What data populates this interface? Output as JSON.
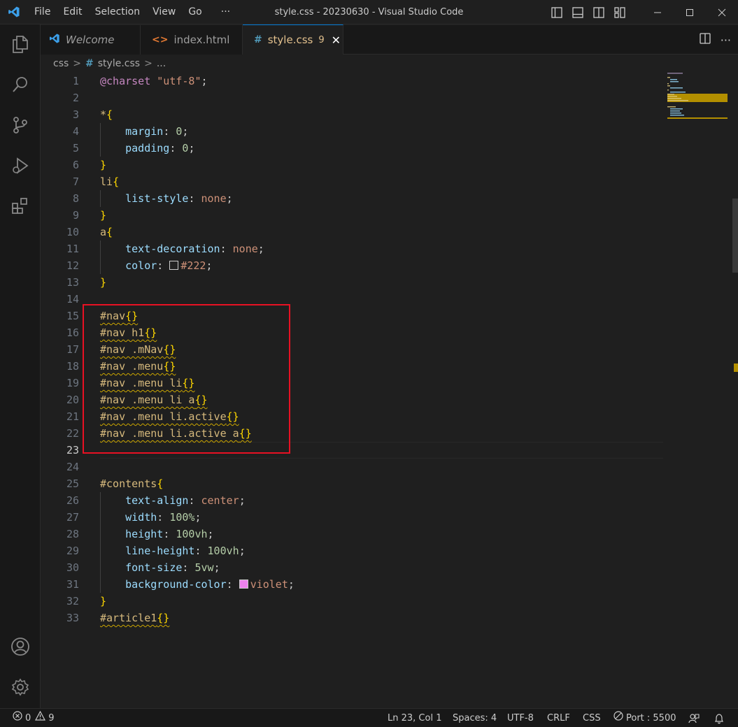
{
  "window": {
    "title": "style.css - 20230630 - Visual Studio Code"
  },
  "menu": [
    "File",
    "Edit",
    "Selection",
    "View",
    "Go",
    "···"
  ],
  "tabs": [
    {
      "label": "Welcome",
      "icon": "vscode-icon"
    },
    {
      "label": "index.html",
      "icon": "html-icon",
      "icon_glyph": "<>"
    },
    {
      "label": "style.css",
      "icon": "css-hash-icon",
      "icon_glyph": "#",
      "badge": "9",
      "close": "✕"
    }
  ],
  "breadcrumb": {
    "folder": "css",
    "sep": ">",
    "hash": "#",
    "file": "style.css",
    "more": "..."
  },
  "editor": {
    "current_line": "23",
    "lines": [
      {
        "n": "1",
        "indent": "",
        "tokens": [
          {
            "c": "t-at",
            "t": "@charset"
          },
          {
            "c": "t-punc",
            "t": " "
          },
          {
            "c": "t-str",
            "t": "\"utf-8\""
          },
          {
            "c": "t-punc",
            "t": ";"
          }
        ]
      },
      {
        "n": "2",
        "indent": "",
        "tokens": []
      },
      {
        "n": "3",
        "indent": "",
        "tokens": [
          {
            "c": "t-sel",
            "t": "*"
          },
          {
            "c": "t-brace",
            "t": "{"
          }
        ]
      },
      {
        "n": "4",
        "indent": "    ",
        "tokens": [
          {
            "c": "t-prop",
            "t": "margin"
          },
          {
            "c": "t-punc",
            "t": ": "
          },
          {
            "c": "t-num",
            "t": "0"
          },
          {
            "c": "t-punc",
            "t": ";"
          }
        ]
      },
      {
        "n": "5",
        "indent": "    ",
        "tokens": [
          {
            "c": "t-prop",
            "t": "padding"
          },
          {
            "c": "t-punc",
            "t": ": "
          },
          {
            "c": "t-num",
            "t": "0"
          },
          {
            "c": "t-punc",
            "t": ";"
          }
        ]
      },
      {
        "n": "6",
        "indent": "",
        "tokens": [
          {
            "c": "t-brace",
            "t": "}"
          }
        ]
      },
      {
        "n": "7",
        "indent": "",
        "tokens": [
          {
            "c": "t-tag",
            "t": "li"
          },
          {
            "c": "t-brace",
            "t": "{"
          }
        ]
      },
      {
        "n": "8",
        "indent": "    ",
        "tokens": [
          {
            "c": "t-prop",
            "t": "list-style"
          },
          {
            "c": "t-punc",
            "t": ": "
          },
          {
            "c": "t-val",
            "t": "none"
          },
          {
            "c": "t-punc",
            "t": ";"
          }
        ]
      },
      {
        "n": "9",
        "indent": "",
        "tokens": [
          {
            "c": "t-brace",
            "t": "}"
          }
        ]
      },
      {
        "n": "10",
        "indent": "",
        "tokens": [
          {
            "c": "t-tag",
            "t": "a"
          },
          {
            "c": "t-brace",
            "t": "{"
          }
        ]
      },
      {
        "n": "11",
        "indent": "    ",
        "tokens": [
          {
            "c": "t-prop",
            "t": "text-decoration"
          },
          {
            "c": "t-punc",
            "t": ": "
          },
          {
            "c": "t-val",
            "t": "none"
          },
          {
            "c": "t-punc",
            "t": ";"
          }
        ]
      },
      {
        "n": "12",
        "indent": "    ",
        "tokens": [
          {
            "c": "t-prop",
            "t": "color"
          },
          {
            "c": "t-punc",
            "t": ": "
          },
          {
            "c": "swatch",
            "t": "",
            "color": "#222222"
          },
          {
            "c": "t-val",
            "t": "#222"
          },
          {
            "c": "t-punc",
            "t": ";"
          }
        ]
      },
      {
        "n": "13",
        "indent": "",
        "tokens": [
          {
            "c": "t-brace",
            "t": "}"
          }
        ]
      },
      {
        "n": "14",
        "indent": "",
        "tokens": []
      },
      {
        "n": "15",
        "indent": "",
        "tokens": [
          {
            "c": "t-sel warn",
            "t": "#nav"
          },
          {
            "c": "t-brace warn",
            "t": "{}"
          }
        ]
      },
      {
        "n": "16",
        "indent": "",
        "tokens": [
          {
            "c": "t-sel warn",
            "t": "#nav h1"
          },
          {
            "c": "t-brace warn",
            "t": "{}"
          }
        ]
      },
      {
        "n": "17",
        "indent": "",
        "tokens": [
          {
            "c": "t-sel warn",
            "t": "#nav .mNav"
          },
          {
            "c": "t-brace warn",
            "t": "{}"
          }
        ]
      },
      {
        "n": "18",
        "indent": "",
        "tokens": [
          {
            "c": "t-sel warn",
            "t": "#nav .menu"
          },
          {
            "c": "t-brace warn",
            "t": "{}"
          }
        ]
      },
      {
        "n": "19",
        "indent": "",
        "tokens": [
          {
            "c": "t-sel warn",
            "t": "#nav .menu li"
          },
          {
            "c": "t-brace warn",
            "t": "{}"
          }
        ]
      },
      {
        "n": "20",
        "indent": "",
        "tokens": [
          {
            "c": "t-sel warn",
            "t": "#nav .menu li a"
          },
          {
            "c": "t-brace warn",
            "t": "{}"
          }
        ]
      },
      {
        "n": "21",
        "indent": "",
        "tokens": [
          {
            "c": "t-sel warn",
            "t": "#nav .menu li.active"
          },
          {
            "c": "t-brace warn",
            "t": "{}"
          }
        ]
      },
      {
        "n": "22",
        "indent": "",
        "tokens": [
          {
            "c": "t-sel warn",
            "t": "#nav .menu li.active a"
          },
          {
            "c": "t-brace warn",
            "t": "{}"
          }
        ]
      },
      {
        "n": "23",
        "indent": "",
        "tokens": []
      },
      {
        "n": "24",
        "indent": "",
        "tokens": []
      },
      {
        "n": "25",
        "indent": "",
        "tokens": [
          {
            "c": "t-sel",
            "t": "#contents"
          },
          {
            "c": "t-brace",
            "t": "{"
          }
        ]
      },
      {
        "n": "26",
        "indent": "    ",
        "tokens": [
          {
            "c": "t-prop",
            "t": "text-align"
          },
          {
            "c": "t-punc",
            "t": ": "
          },
          {
            "c": "t-val",
            "t": "center"
          },
          {
            "c": "t-punc",
            "t": ";"
          }
        ]
      },
      {
        "n": "27",
        "indent": "    ",
        "tokens": [
          {
            "c": "t-prop",
            "t": "width"
          },
          {
            "c": "t-punc",
            "t": ": "
          },
          {
            "c": "t-num",
            "t": "100%"
          },
          {
            "c": "t-punc",
            "t": ";"
          }
        ]
      },
      {
        "n": "28",
        "indent": "    ",
        "tokens": [
          {
            "c": "t-prop",
            "t": "height"
          },
          {
            "c": "t-punc",
            "t": ": "
          },
          {
            "c": "t-num",
            "t": "100vh"
          },
          {
            "c": "t-punc",
            "t": ";"
          }
        ]
      },
      {
        "n": "29",
        "indent": "    ",
        "tokens": [
          {
            "c": "t-prop",
            "t": "line-height"
          },
          {
            "c": "t-punc",
            "t": ": "
          },
          {
            "c": "t-num",
            "t": "100vh"
          },
          {
            "c": "t-punc",
            "t": ";"
          }
        ]
      },
      {
        "n": "30",
        "indent": "    ",
        "tokens": [
          {
            "c": "t-prop",
            "t": "font-size"
          },
          {
            "c": "t-punc",
            "t": ": "
          },
          {
            "c": "t-num",
            "t": "5vw"
          },
          {
            "c": "t-punc",
            "t": ";"
          }
        ]
      },
      {
        "n": "31",
        "indent": "    ",
        "tokens": [
          {
            "c": "t-prop",
            "t": "background-color"
          },
          {
            "c": "t-punc",
            "t": ": "
          },
          {
            "c": "swatch",
            "t": "",
            "color": "#ee82ee"
          },
          {
            "c": "t-val",
            "t": "violet"
          },
          {
            "c": "t-punc",
            "t": ";"
          }
        ]
      },
      {
        "n": "32",
        "indent": "",
        "tokens": [
          {
            "c": "t-brace",
            "t": "}"
          }
        ]
      },
      {
        "n": "33",
        "indent": "",
        "tokens": [
          {
            "c": "t-sel warn",
            "t": "#article1"
          },
          {
            "c": "t-brace warn",
            "t": "{}"
          }
        ]
      }
    ]
  },
  "status": {
    "errors": "0",
    "warnings": "9",
    "position": "Ln 23, Col 1",
    "spaces": "Spaces: 4",
    "encoding": "UTF-8",
    "eol": "CRLF",
    "language": "CSS",
    "port": "Port : 5500"
  },
  "colors": {
    "accent": "#0078d4",
    "warning": "#cca700",
    "highlight_box": "#e81123",
    "tab_modified": "#e2c08d"
  }
}
